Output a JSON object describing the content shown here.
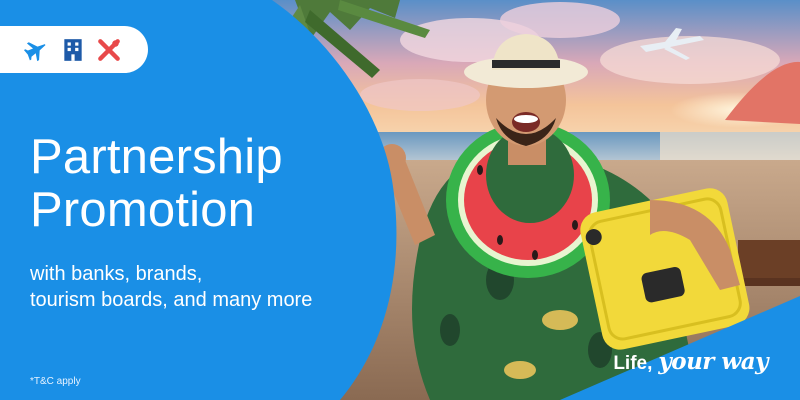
{
  "badge": {
    "icons": [
      "airplane-icon",
      "building-hotel-icon",
      "activity-x-icon"
    ],
    "colors": {
      "airplane": "#1a8fe6",
      "building": "#1e5aa8",
      "activity": "#e8494a"
    }
  },
  "headline": {
    "line1": "Partnership",
    "line2": "Promotion"
  },
  "subheadline": {
    "line1": "with banks, brands,",
    "line2": "tourism boards, and many more"
  },
  "disclaimer": "*T&C apply",
  "tagline": {
    "plain": "Life,",
    "script": "your way"
  },
  "colors": {
    "brand_blue": "#1a8fe6",
    "text": "#ffffff"
  }
}
